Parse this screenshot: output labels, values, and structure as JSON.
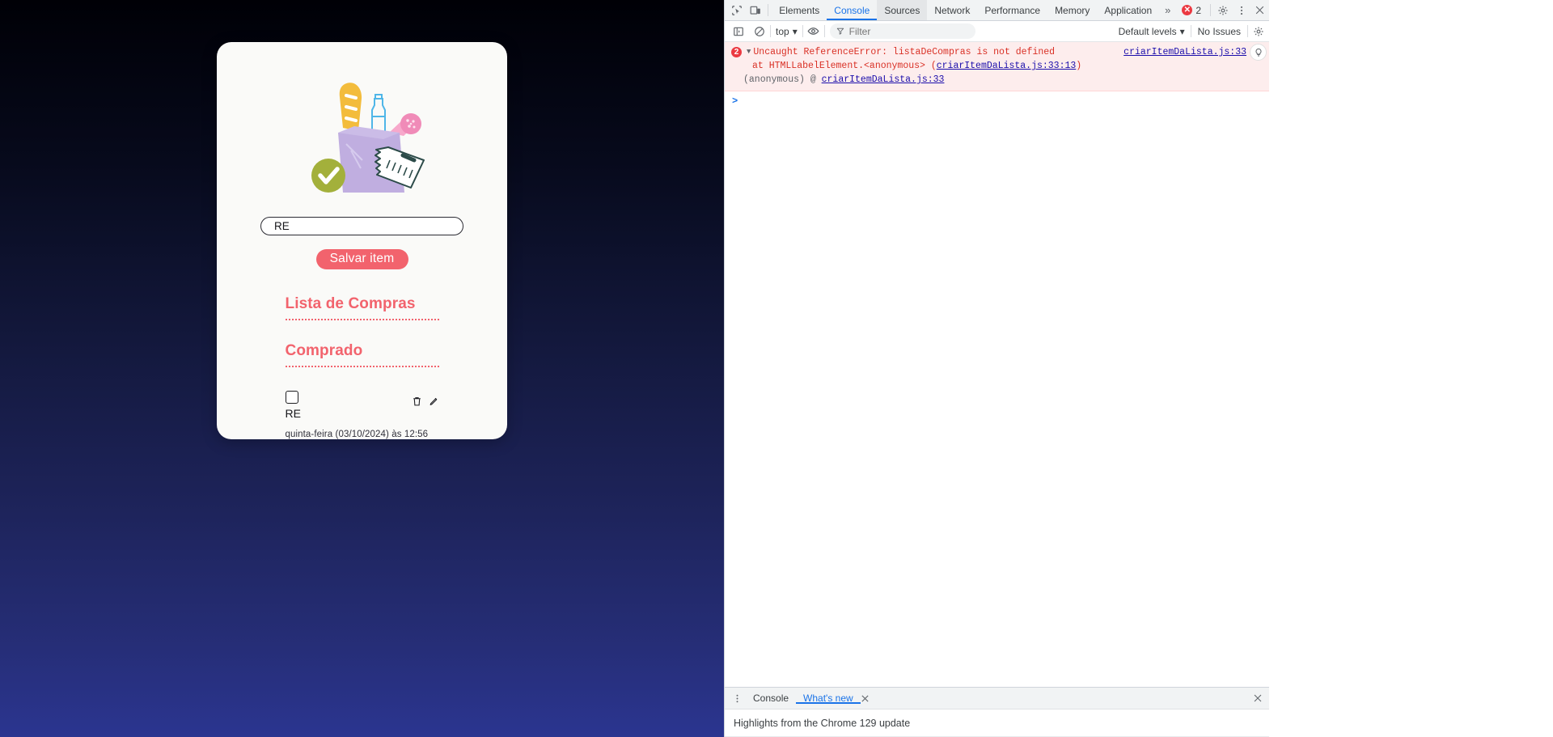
{
  "app": {
    "input_value": "RE",
    "input_placeholder": "",
    "save_label": "Salvar item",
    "heading_list": "Lista de Compras",
    "heading_bought": "Comprado",
    "item": {
      "label": "RE",
      "date": "quinta-feira (03/10/2024) às 12:56",
      "checked": false
    },
    "colors": {
      "accent": "#f2636d",
      "card_bg": "#fafaf8",
      "bg_top": "#000006",
      "bg_bottom": "#2b3590",
      "check_badge": "#a3b03b",
      "bag": "#c0aee0",
      "bread": "#f3bc3c",
      "sausage": "#f7a8cb",
      "bottle": "#4fb6e8"
    }
  },
  "devtools": {
    "tabs": [
      {
        "label": "Elements",
        "active": false
      },
      {
        "label": "Console",
        "active": true
      },
      {
        "label": "Sources",
        "active": false
      },
      {
        "label": "Network",
        "active": false
      },
      {
        "label": "Performance",
        "active": false
      },
      {
        "label": "Memory",
        "active": false
      },
      {
        "label": "Application",
        "active": false
      }
    ],
    "more_tabs": "»",
    "error_count": "2",
    "error_badge_symbol": "✕",
    "toolbar": {
      "context": "top",
      "context_caret": "▾",
      "filter_placeholder": "Filter",
      "levels": "Default levels",
      "levels_caret": "▾",
      "issues": "No Issues"
    },
    "console": {
      "error_badge_count": "2",
      "caret": "▼",
      "line1": "Uncaught ReferenceError: listaDeCompras is not defined",
      "line2_prefix": "    at HTMLLabelElement.<anonymous> (",
      "line2_link": "criarItemDaLista.js:33:13",
      "line2_suffix": ")",
      "line3_prefix": "  (anonymous) @ ",
      "line3_link": "criarItemDaLista.js:33",
      "right_link": "criarItemDaLista.js:33",
      "prompt": ">"
    },
    "drawer": {
      "tabs": [
        {
          "label": "Console",
          "active": false
        },
        {
          "label": "What's new",
          "active": true
        }
      ],
      "content": "Highlights from the Chrome 129 update"
    },
    "icons": {
      "inspect": "inspect-element-icon",
      "device": "device-toolbar-icon",
      "sidebar": "console-sidebar-icon",
      "clear": "clear-console-icon",
      "eye": "live-expression-icon",
      "filter": "filter-icon",
      "gear": "settings-gear-icon",
      "kebab": "more-options-icon",
      "close": "close-icon",
      "lamp": "issue-lamp-icon"
    }
  }
}
